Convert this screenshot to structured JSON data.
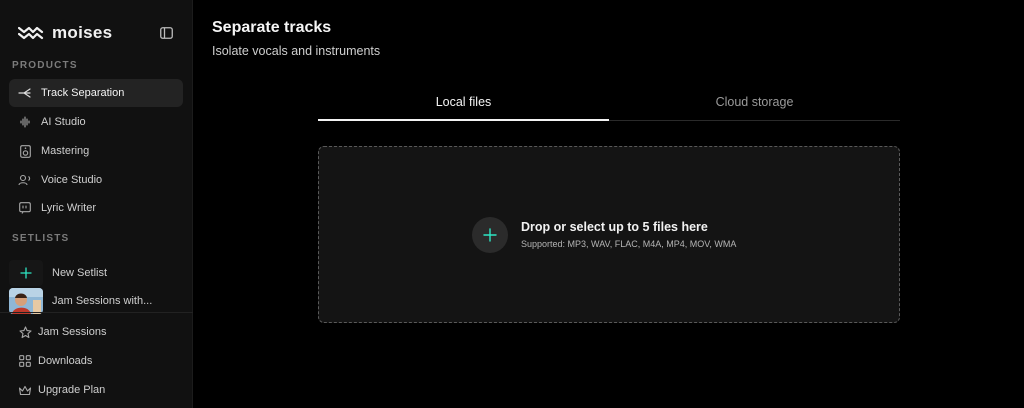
{
  "brand": {
    "name": "moises"
  },
  "sidebar": {
    "products_label": "PRODUCTS",
    "products": [
      {
        "label": "Track Separation",
        "icon": "track-separation-icon",
        "active": true
      },
      {
        "label": "AI Studio",
        "icon": "waveform-icon",
        "active": false
      },
      {
        "label": "Mastering",
        "icon": "speaker-icon",
        "active": false
      },
      {
        "label": "Voice Studio",
        "icon": "voice-icon",
        "active": false
      },
      {
        "label": "Lyric Writer",
        "icon": "lyric-icon",
        "active": false
      }
    ],
    "setlists_label": "SETLISTS",
    "setlists": [
      {
        "label": "New Setlist",
        "icon": "plus-icon"
      },
      {
        "label": "Jam Sessions with...",
        "icon": "setlist-thumbnail"
      }
    ],
    "footer": [
      {
        "label": "Jam Sessions",
        "icon": "star-icon"
      },
      {
        "label": "Downloads",
        "icon": "grid-icon"
      },
      {
        "label": "Upgrade Plan",
        "icon": "crown-icon"
      }
    ]
  },
  "main": {
    "title": "Separate tracks",
    "subtitle": "Isolate vocals and instruments",
    "tabs": [
      {
        "label": "Local files",
        "active": true
      },
      {
        "label": "Cloud storage",
        "active": false
      }
    ],
    "dropzone": {
      "title": "Drop or select up to 5 files here",
      "supported": "Supported: MP3, WAV, FLAC, M4A, MP4, MOV, WMA"
    }
  },
  "colors": {
    "accent": "#2ee6c4",
    "background": "#000000",
    "sidebar": "#111111"
  }
}
